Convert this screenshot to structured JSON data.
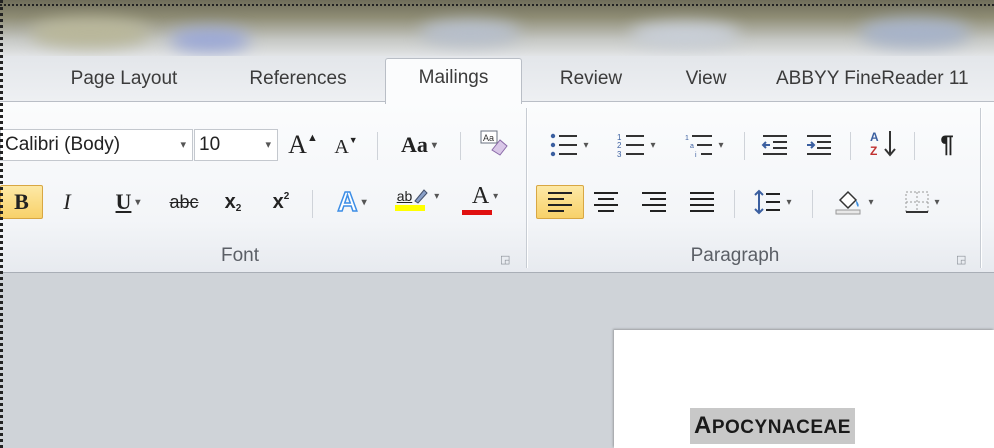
{
  "tabs": [
    {
      "label": "Page Layout",
      "active": false
    },
    {
      "label": "References",
      "active": false
    },
    {
      "label": "Mailings",
      "active": true
    },
    {
      "label": "Review",
      "active": false
    },
    {
      "label": "View",
      "active": false
    },
    {
      "label": "ABBYY FineReader 11",
      "active": false
    }
  ],
  "font_group": {
    "label": "Font",
    "font_name": "Calibri (Body)",
    "font_size": "10",
    "grow_font": "A",
    "shrink_font": "A",
    "change_case": "Aa",
    "bold": "B",
    "italic": "I",
    "underline": "U",
    "strikethrough": "abc",
    "subscript": "x",
    "subscript_mark": "2",
    "superscript": "x",
    "superscript_mark": "2",
    "text_effects": "A",
    "highlight": "ab",
    "font_color": "A"
  },
  "paragraph_group": {
    "label": "Paragraph",
    "pilcrow": "¶"
  },
  "document": {
    "heading_first": "A",
    "heading_rest": "POCYNACEAE"
  },
  "colors": {
    "accent_pressed": "#f8d169",
    "highlight_yellow": "#ffff00",
    "font_red": "#e01010",
    "effects_blue": "#3d8ee6"
  }
}
